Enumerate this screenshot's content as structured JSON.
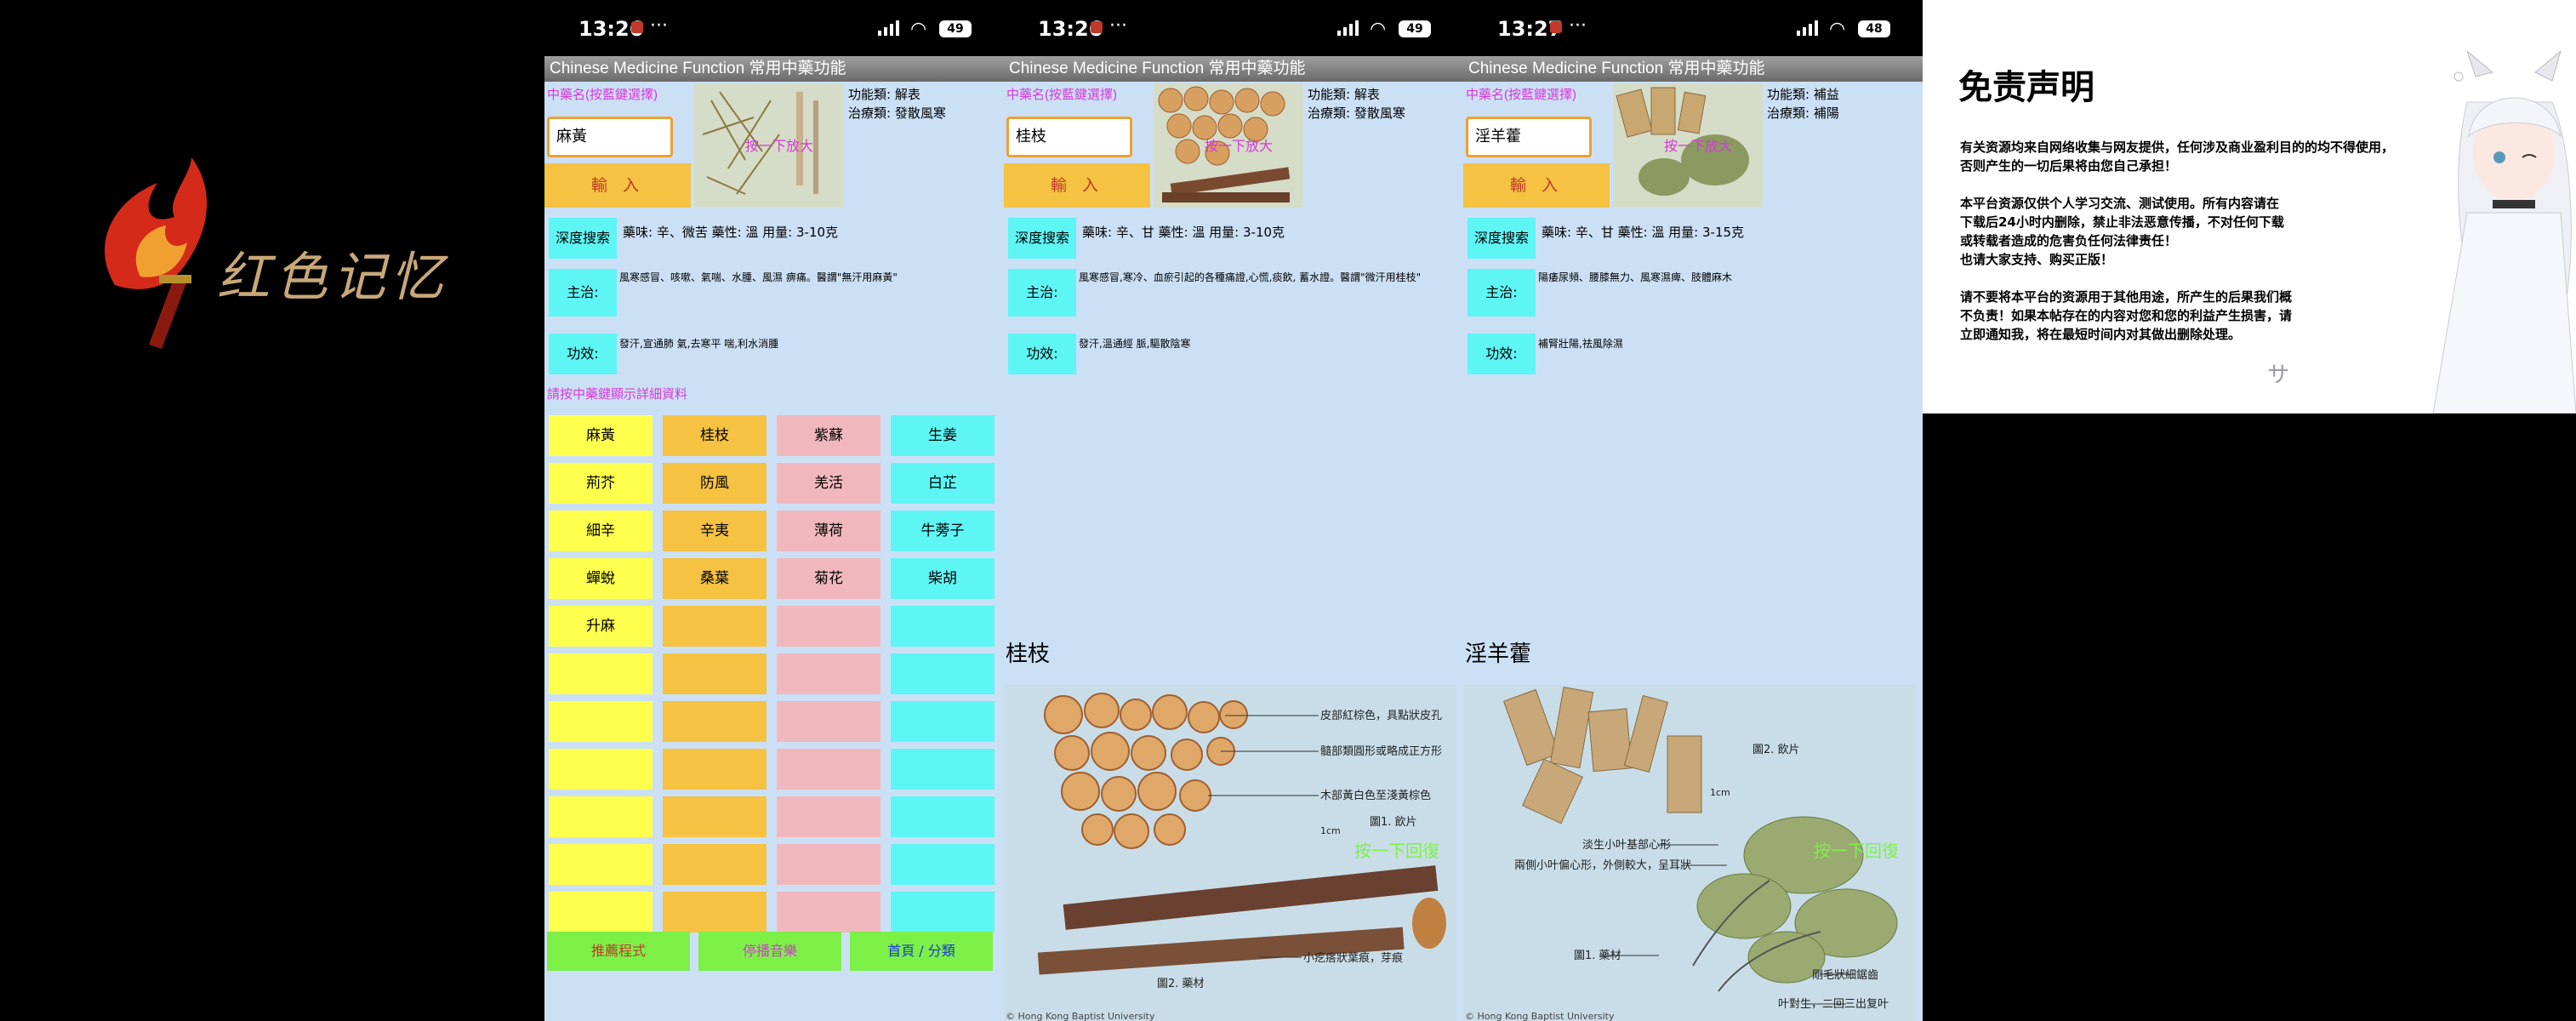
{
  "logo": {
    "text": "红色记忆"
  },
  "phones": [
    {
      "time": "13:26",
      "battery": "49",
      "title": "Chinese Medicine Function 常用中藥功能",
      "prompt": "中藥名(按藍鍵選擇)",
      "input_value": "麻黃",
      "enter_label": "輸 入",
      "tap_enlarge": "按一下放大",
      "func_type": "功能類: 解表",
      "treat_type": "治療類: 發散風寒",
      "deep_search": "深度搜索",
      "taste": "藥味: 辛、微苦  藥性: 溫  用量: 3-10克",
      "main_label": "主治:",
      "main_text": "風寒感冒、咳嗽、氣喘、水腫、風濕 痹痛。醫謂\"無汗用麻黃\"",
      "effect_label": "功效:",
      "effect_text": "發汗,宣通肺 氣,去寒平 喘,利水消腫",
      "hint": "請按中藥鍵顯示詳細資料",
      "grid": [
        [
          "麻黃",
          "桂枝",
          "紫蘇",
          "生姜"
        ],
        [
          "荊芥",
          "防風",
          "羌活",
          "白芷"
        ],
        [
          "細辛",
          "辛夷",
          "薄荷",
          "牛蒡子"
        ],
        [
          "蟬蛻",
          "桑葉",
          "菊花",
          "柴胡"
        ],
        [
          "升麻",
          "",
          "",
          ""
        ],
        [
          "",
          "",
          "",
          ""
        ],
        [
          "",
          "",
          "",
          ""
        ],
        [
          "",
          "",
          "",
          ""
        ],
        [
          "",
          "",
          "",
          ""
        ],
        [
          "",
          "",
          "",
          ""
        ],
        [
          "",
          "",
          "",
          ""
        ]
      ],
      "bottom_buttons": [
        "推薦程式",
        "停播音樂",
        "首頁 / 分類"
      ]
    },
    {
      "time": "13:26",
      "battery": "49",
      "title": "Chinese Medicine Function 常用中藥功能",
      "prompt": "中藥名(按藍鍵選擇)",
      "input_value": "桂枝",
      "enter_label": "輸 入",
      "tap_enlarge": "按一下放大",
      "func_type": "功能類: 解表",
      "treat_type": "治療類: 發散風寒",
      "deep_search": "深度搜索",
      "taste": "藥味: 辛、甘  藥性: 溫  用量: 3-10克",
      "main_label": "主治:",
      "main_text": "風寒感冒,寒冷、血瘀引起的各種痛證,心慌,痰飲, 蓄水證。醫謂\"微汗用桂枝\"",
      "effect_label": "功效:",
      "effect_text": "發汗,溫通經 脈,驅散陰寒",
      "big_name": "桂枝",
      "big_tap": "按一下回復",
      "fig_labels": [
        "皮部紅棕色，具點狀皮孔",
        "髓部類圓形或略成正方形",
        "木部黃白色至淺黃棕色",
        "圖1. 飲片",
        "1cm",
        "小疙瘩狀葉痕，芽痕",
        "圖2. 藥材",
        "© Hong Kong Baptist University"
      ]
    },
    {
      "time": "13:27",
      "battery": "48",
      "title": "Chinese Medicine Function 常用中藥功能",
      "prompt": "中藥名(按藍鍵選擇)",
      "input_value": "淫羊藿",
      "enter_label": "輸 入",
      "tap_enlarge": "按一下放大",
      "func_type": "功能類: 補益",
      "treat_type": "治療類: 補陽",
      "deep_search": "深度搜索",
      "taste": "藥味: 辛、甘  藥性: 溫  用量: 3-15克",
      "main_label": "主治:",
      "main_text": "陽痿尿頻、腰膝無力、風寒濕痺、肢體麻木",
      "effect_label": "功效:",
      "effect_text": "補腎壯陽,祛風除濕",
      "big_name": "淫羊藿",
      "big_tap": "按一下回復",
      "fig_labels": [
        "圖2. 飲片",
        "1cm",
        "淡生小叶基部心形",
        "兩側小叶偏心形，外側較大，呈耳狀",
        "圖1. 藥材",
        "剛毛狀細鋸齒",
        "叶對生，二回三出复叶",
        "© Hong Kong Baptist University"
      ]
    }
  ],
  "disclaimer": {
    "title": "免责声明",
    "p1": [
      "有关资源均来自网络收集与网友提供，任何涉及商业盈利目的的均不得使用，",
      "否则产生的一切后果将由您自己承担！"
    ],
    "p2": [
      "本平台资源仅供个人学习交流、测试使用。所有内容请在",
      "下载后24小时内删除，禁止非法恶意传播，不对任何下载",
      "或转载者造成的危害负任何法律责任！",
      "也请大家支持、购买正版！"
    ],
    "p3": [
      "请不要将本平台的资源用于其他用途，所产生的后果我们概",
      "不负责！如果本帖存在的内容对您和您的利益产生损害，请",
      "立即通知我，将在最短时间内对其做出删除处理。"
    ],
    "corner": "サ"
  },
  "colors": {
    "app_bg": "#cce0f5",
    "yellow": "#ffff4d",
    "orange": "#f5c242",
    "pink": "#f0b8bd",
    "cyan": "#5ef5f5",
    "green": "#7df048",
    "magenta": "#d63ad6"
  }
}
